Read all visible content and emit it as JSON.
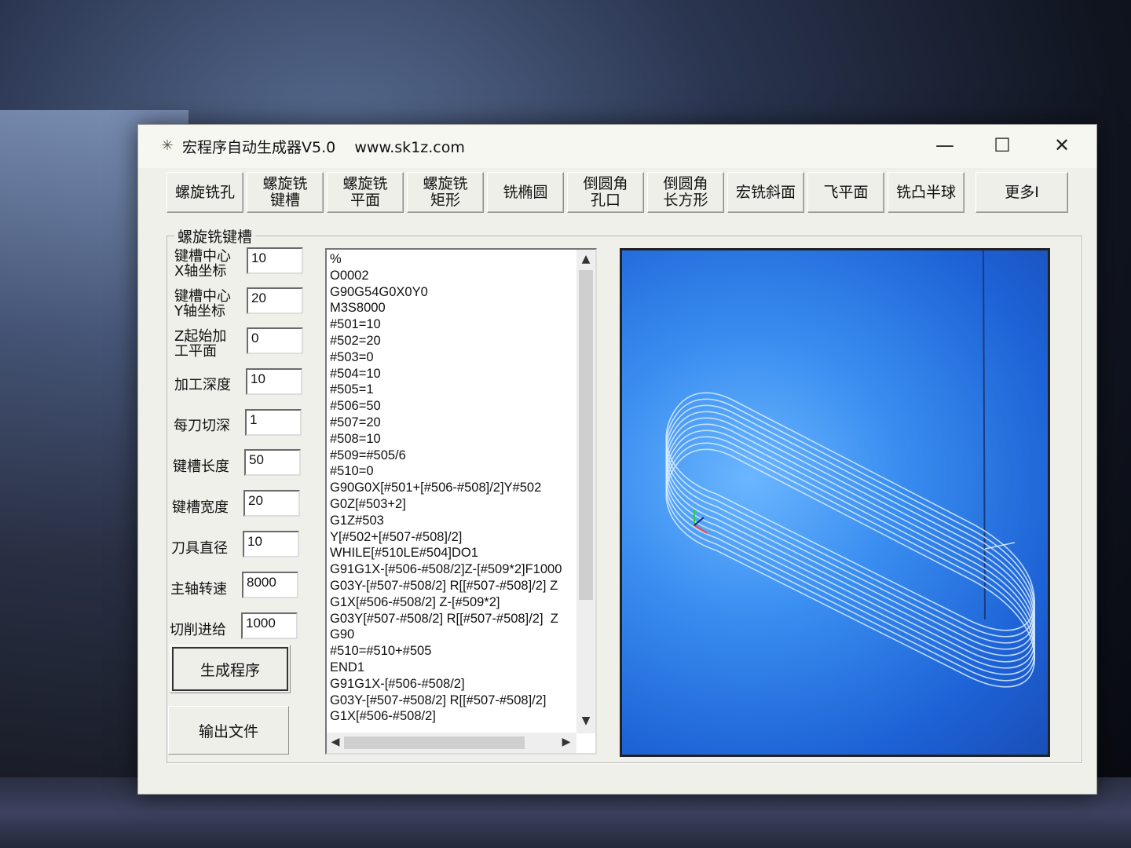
{
  "window": {
    "title": "宏程序自动生成器V5.0    www.sk1z.com",
    "minimize": "—",
    "maximize": "☐",
    "close": "✕"
  },
  "toolbar": [
    "螺旋铣孔",
    "螺旋铣 键槽",
    "螺旋铣 平面",
    "螺旋铣 矩形",
    "铣椭圆",
    "倒圆角 孔口",
    "倒圆角 长方形",
    "宏铣斜面",
    "飞平面",
    "铣凸半球",
    "更多I"
  ],
  "group": {
    "title": "螺旋铣键槽",
    "fields": [
      {
        "label": "键槽中心 X轴坐标",
        "value": "10"
      },
      {
        "label": "键槽中心 Y轴坐标",
        "value": "20"
      },
      {
        "label": "Z起始加 工平面",
        "value": "0"
      },
      {
        "label": "加工深度",
        "value": "10"
      },
      {
        "label": "每刀切深",
        "value": "1"
      },
      {
        "label": "键槽长度",
        "value": "50"
      },
      {
        "label": "键槽宽度",
        "value": "20"
      },
      {
        "label": "刀具直径",
        "value": "10"
      },
      {
        "label": "主轴转速",
        "value": "8000"
      },
      {
        "label": "切削进给",
        "value": "1000"
      }
    ],
    "generate_label": "生成程序",
    "export_label": "输出文件"
  },
  "code": [
    "%",
    "O0002",
    "G90G54G0X0Y0",
    "M3S8000",
    "#501=10",
    "#502=20",
    "#503=0",
    "#504=10",
    "#505=1",
    "#506=50",
    "#507=20",
    "#508=10",
    "#509=#505/6",
    "#510=0",
    "G90G0X[#501+[#506-#508]/2]Y#502",
    "G0Z[#503+2]",
    "G1Z#503",
    "Y[#502+[#507-#508]/2]",
    "WHILE[#510LE#504]DO1",
    "G91G1X-[#506-#508/2]Z-[#509*2]F1000",
    "G03Y-[#507-#508/2] R[[#507-#508]/2] Z",
    "G1X[#506-#508/2] Z-[#509*2]",
    "G03Y[#507-#508/2] R[[#507-#508]/2]  Z",
    "G90",
    "#510=#510+#505",
    "END1",
    "G91G1X-[#506-#508/2]",
    "G03Y-[#507-#508/2] R[[#507-#508]/2]",
    "G1X[#506-#508/2]"
  ],
  "colors": {
    "viewport_bg": "#2f7fe8",
    "toolpath": "#d8ecff"
  }
}
